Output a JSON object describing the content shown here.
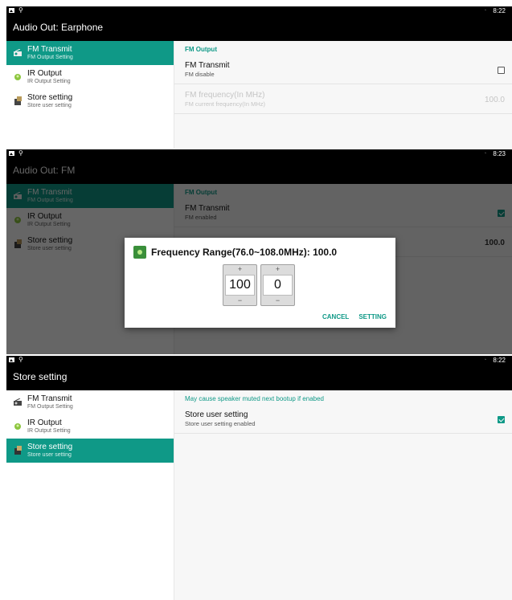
{
  "panel1": {
    "status": {
      "time": "8:22"
    },
    "app_title": "Audio Out: Earphone",
    "sidebar": [
      {
        "title": "FM Transmit",
        "subtitle": "FM Output Setting"
      },
      {
        "title": "IR Output",
        "subtitle": "IR Output Setting"
      },
      {
        "title": "Store setting",
        "subtitle": "Store user setting"
      }
    ],
    "category": "FM Output",
    "fm_transmit": {
      "title": "FM Transmit",
      "summary": "FM disable",
      "checked": false
    },
    "fm_frequency": {
      "title": "FM frequency(In MHz)",
      "summary": "FM current frequency(In MHz)",
      "value": "100.0"
    }
  },
  "panel2": {
    "status": {
      "time": "8:23"
    },
    "app_title": "Audio Out: FM",
    "sidebar": [
      {
        "title": "FM Transmit",
        "subtitle": "FM Output Setting"
      },
      {
        "title": "IR Output",
        "subtitle": "IR Output Setting"
      },
      {
        "title": "Store setting",
        "subtitle": "Store user setting"
      }
    ],
    "category": "FM Output",
    "fm_transmit": {
      "title": "FM Transmit",
      "summary": "FM enabled",
      "checked": true
    },
    "fm_frequency_value": "100.0",
    "dialog": {
      "title": "Frequency Range(76.0~108.0MHz): 100.0",
      "integer_value": "100",
      "decimal_value": "0",
      "increment": "+",
      "decrement": "−",
      "cancel": "CANCEL",
      "confirm": "SETTING"
    }
  },
  "panel3": {
    "status": {
      "time": "8:22"
    },
    "app_title": "Store setting",
    "sidebar": [
      {
        "title": "FM Transmit",
        "subtitle": "FM Output Setting"
      },
      {
        "title": "IR Output",
        "subtitle": "IR Output Setting"
      },
      {
        "title": "Store setting",
        "subtitle": "Store user setting"
      }
    ],
    "category": "May cause speaker muted next bootup if enabed",
    "store_user": {
      "title": "Store user setting",
      "summary": "Store user setting enabled",
      "checked": true
    }
  },
  "icons": {
    "statusbar_left": [
      "image-icon",
      "usb-icon"
    ],
    "statusbar_right": [
      "wifi-icon"
    ],
    "sidebar": [
      "radio-icon",
      "ir-icon",
      "storage-icon"
    ],
    "dialog": "fm-app-icon"
  },
  "colors": {
    "accent": "#0f9987",
    "appbar": "#000000",
    "background": "#f7f7f7"
  }
}
